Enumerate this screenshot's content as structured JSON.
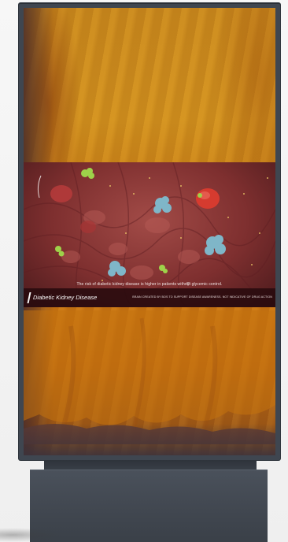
{
  "video_overlay": {
    "caption": "The risk of diabetic kidney disease is higher in patients without glycemic control.",
    "title": "Diabetic Kidney Disease",
    "disclaimer": "BRAIN CREATED BY BOS TO SUPPORT DISEASE AWARENESS. NOT INDICATIVE OF DRUG ACTION"
  },
  "colors": {
    "bezel": "#3f4650",
    "stand": "#424851",
    "fabric": "#c98a1e",
    "video_bg": "#8a3535",
    "info_bar": "#28090e",
    "red_cell": "#d63b2f",
    "green_particle": "#9ed24a",
    "blue_particle": "#7fb6c8"
  },
  "icons": {
    "wifi": "wifi-icon",
    "corner": "arc-icon"
  }
}
